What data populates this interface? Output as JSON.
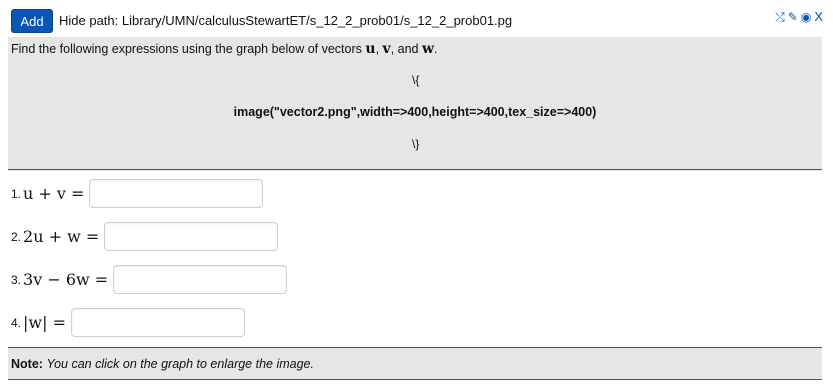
{
  "toolbar": {
    "add_label": "Add",
    "hide_path_label": "Hide path:",
    "path": "Library/UMN/calculusStewartET/s_12_2_prob01/s_12_2_prob01.pg",
    "icons": [
      "shuffle-icon",
      "edit-icon",
      "view-icon",
      "close-icon"
    ],
    "close_label": "X",
    "accent_color": "#0a56b5"
  },
  "problem": {
    "prompt_prefix": "Find the following expressions using the graph below of vectors",
    "vec_u": "u",
    "sep1": ",",
    "vec_v": "v",
    "sep2": ", and",
    "vec_w": "w",
    "period": ".",
    "tex_open": "\\{",
    "image_code": "image(\"vector2.png\",width=>400,height=>400,tex_size=>400)",
    "tex_close": "\\}"
  },
  "answers": [
    {
      "number": "1.",
      "expression": "u + v ="
    },
    {
      "number": "2.",
      "expression": "2u + w ="
    },
    {
      "number": "3.",
      "expression": "3v − 6w ="
    },
    {
      "number": "4.",
      "expression": "|w| ="
    }
  ],
  "note": {
    "label": "Note:",
    "text": "You can click on the graph to enlarge the image."
  }
}
